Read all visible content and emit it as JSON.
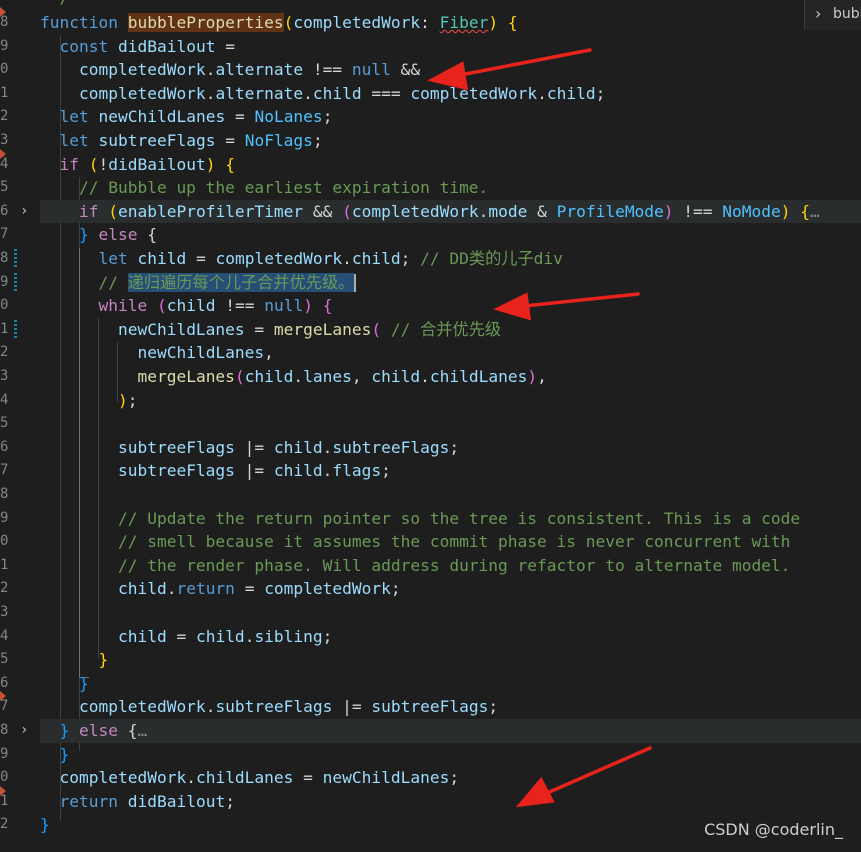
{
  "editor": {
    "breadcrumb_title": "bubble",
    "watermark": "CSDN @coderlin_",
    "line_numbers": [
      "8",
      "9",
      "0",
      "1",
      "2",
      "3",
      "4",
      "5",
      "6",
      "7",
      "8",
      "9",
      "0",
      "1",
      "2",
      "3",
      "4",
      "5",
      "6",
      "7",
      "8",
      "9",
      "0",
      "1",
      "2",
      "3",
      "4",
      "5",
      "6",
      "7",
      "8",
      "9",
      "0",
      "1",
      "2"
    ],
    "lines": [
      {
        "kind": "fn-header",
        "kw": "function",
        "name": "bubbleProperties",
        "param": "completedWork",
        "type": "Fiber"
      },
      {
        "kind": "raw",
        "text": "const didBailout ="
      },
      {
        "kind": "raw",
        "text": "completedWork.alternate !== null &&"
      },
      {
        "kind": "raw",
        "text": "completedWork.alternate.child === completedWork.child;"
      },
      {
        "kind": "raw",
        "text": "let newChildLanes = NoLanes;"
      },
      {
        "kind": "raw",
        "text": "let subtreeFlags = NoFlags;"
      },
      {
        "kind": "raw",
        "text": "if (!didBailout) {"
      },
      {
        "kind": "comment",
        "text": "// Bubble up the earliest expiration time."
      },
      {
        "kind": "raw",
        "text": "if (enableProfilerTimer && (completedWork.mode & ProfileMode) !== NoMode) {…"
      },
      {
        "kind": "raw",
        "text": "} else {"
      },
      {
        "kind": "raw",
        "text": "let child = completedWork.child; // DD类的儿子div"
      },
      {
        "kind": "comment",
        "text": "// 递归遍历每个儿子合并优先级。"
      },
      {
        "kind": "raw",
        "text": "while (child !== null) {"
      },
      {
        "kind": "raw",
        "text": "newChildLanes = mergeLanes( // 合并优先级"
      },
      {
        "kind": "raw",
        "text": "newChildLanes,"
      },
      {
        "kind": "raw",
        "text": "mergeLanes(child.lanes, child.childLanes),"
      },
      {
        "kind": "raw",
        "text": ");"
      },
      {
        "kind": "raw",
        "text": ""
      },
      {
        "kind": "raw",
        "text": "subtreeFlags |= child.subtreeFlags;"
      },
      {
        "kind": "raw",
        "text": "subtreeFlags |= child.flags;"
      },
      {
        "kind": "raw",
        "text": ""
      },
      {
        "kind": "comment",
        "text": "// Update the return pointer so the tree is consistent. This is a code"
      },
      {
        "kind": "comment",
        "text": "// smell because it assumes the commit phase is never concurrent with"
      },
      {
        "kind": "comment",
        "text": "// the render phase. Will address during refactor to alternate model."
      },
      {
        "kind": "raw",
        "text": "child.return = completedWork;"
      },
      {
        "kind": "raw",
        "text": ""
      },
      {
        "kind": "raw",
        "text": "child = child.sibling;"
      },
      {
        "kind": "raw",
        "text": "}"
      },
      {
        "kind": "raw",
        "text": "}"
      },
      {
        "kind": "raw",
        "text": "completedWork.subtreeFlags |= subtreeFlags;"
      },
      {
        "kind": "raw",
        "text": "} else {…"
      },
      {
        "kind": "raw",
        "text": "}"
      },
      {
        "kind": "raw",
        "text": "completedWork.childLanes = newChildLanes;"
      },
      {
        "kind": "raw",
        "text": "return didBailout;"
      },
      {
        "kind": "raw",
        "text": "}"
      }
    ]
  },
  "colors": {
    "background": "#1e1e1e",
    "keyword": "#569cd6",
    "control": "#c586c0",
    "function": "#dcdcaa",
    "variable": "#9cdcfe",
    "type": "#4ec9b0",
    "comment": "#6a9955",
    "constant": "#4fc1ff",
    "annotation_arrow": "#e8231c"
  }
}
